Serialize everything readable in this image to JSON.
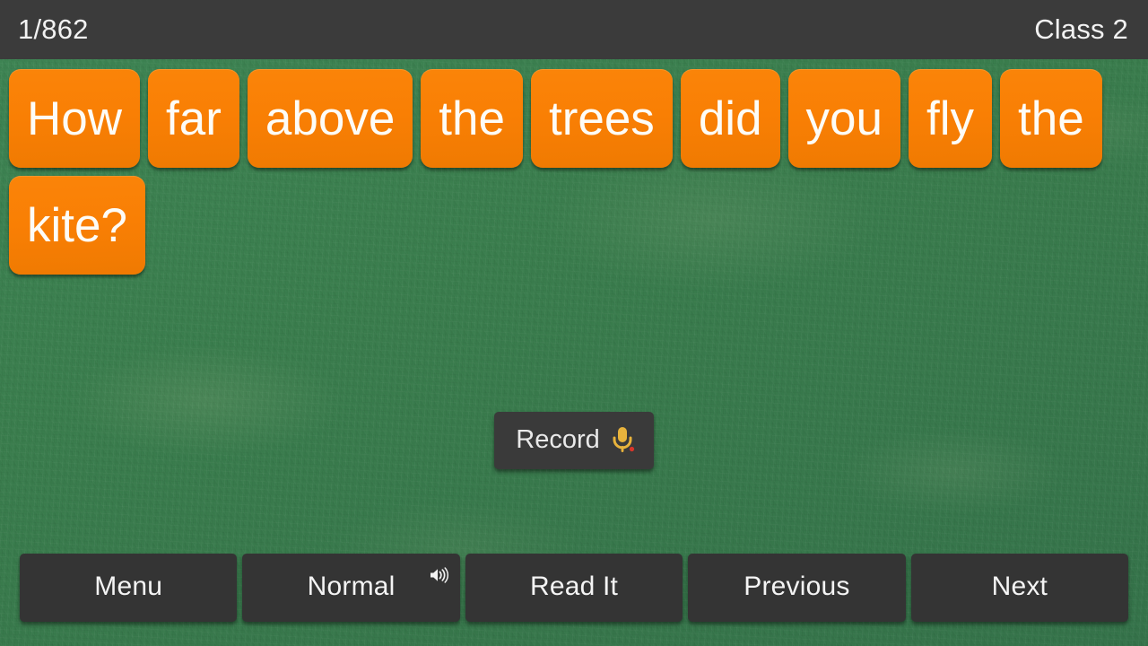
{
  "header": {
    "progress": "1/862",
    "class_label": "Class 2"
  },
  "sentence": {
    "full_text": "How far above the trees did you fly the kite?",
    "words": [
      "How",
      "far",
      "above",
      "the",
      "trees",
      "did",
      "you",
      "fly",
      "the",
      "kite?"
    ]
  },
  "record": {
    "label": "Record",
    "icon": "microphone-icon"
  },
  "toolbar": {
    "buttons": [
      {
        "label": "Menu",
        "icon": null
      },
      {
        "label": "Normal",
        "icon": "speaker-icon"
      },
      {
        "label": "Read It",
        "icon": null
      },
      {
        "label": "Previous",
        "icon": null
      },
      {
        "label": "Next",
        "icon": null
      }
    ]
  },
  "colors": {
    "background_green": "#3b8050",
    "bar_dark": "#3b3b3b",
    "tile_orange": "#f97f04",
    "tile_text": "#fdfcf7",
    "button_dark": "#343434",
    "button_text": "#f4f4f4",
    "mic_gold": "#e8b33c",
    "rec_dot_red": "#d8352a"
  }
}
